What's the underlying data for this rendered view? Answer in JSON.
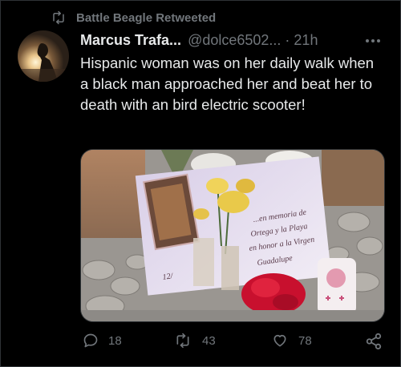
{
  "retweet": {
    "label": "Battle Beagle Retweeted"
  },
  "tweet": {
    "display_name": "Marcus Trafa...",
    "handle": "@dolce6502...",
    "separator": "·",
    "time": "21h",
    "text": "Hispanic woman was on her daily walk when a black man approached her and beat her to death with an bird electric scooter!"
  },
  "media": {
    "card_lines": [
      "...en memoria de",
      "Ortega y la Playa",
      "en honor a la Virgen",
      "Guadalupe"
    ],
    "card_number": "12/"
  },
  "actions": {
    "replies": "18",
    "retweets": "43",
    "likes": "78"
  },
  "colors": {
    "background": "#000000",
    "text": "#e7e9ea",
    "muted": "#71767b",
    "border": "#2f3336"
  },
  "icons": {
    "retweeted": "retweet-icon",
    "more": "more-icon",
    "reply": "reply-icon",
    "retweet": "retweet-icon",
    "like": "heart-icon",
    "share": "share-icon"
  }
}
